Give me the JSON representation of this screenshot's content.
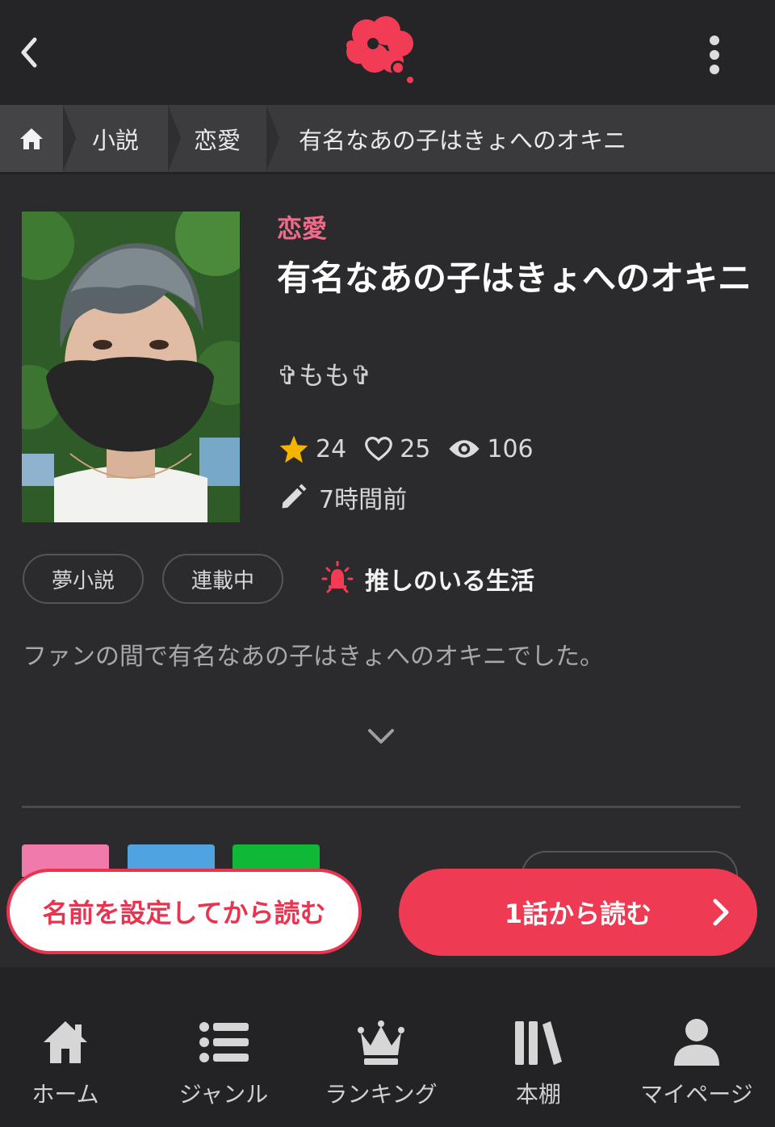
{
  "header": {
    "back_icon": "chevron-left-icon",
    "logo_icon": "cloud-logo-icon",
    "menu_icon": "kebab-menu-icon",
    "brand_color": "#f23c55"
  },
  "breadcrumb": {
    "home_icon": "home-icon",
    "items": [
      "小説",
      "恋愛",
      "有名なあの子はきょへのオキニ"
    ]
  },
  "novel": {
    "genre": "恋愛",
    "title": "有名なあの子はきょへのオキニ",
    "author": "✞もも✞",
    "stars": "24",
    "likes": "25",
    "views": "106",
    "updated": "7時間前",
    "tags": [
      "夢小説",
      "連載中"
    ],
    "contest": "推しのいる生活",
    "synopsis": "ファンの間で有名なあの子はきょへのオキニでした。"
  },
  "actions": {
    "set_name_label": "名前を設定してから読む",
    "read_label": "1話から読む"
  },
  "colors": {
    "genre": "#f06a8a",
    "star": "#f5b400",
    "primary": "#ee3a52",
    "share_pink": "#f07aa9",
    "share_blue": "#4fa3e0",
    "share_green": "#10b838"
  },
  "bottom_nav": {
    "items": [
      {
        "label": "ホーム",
        "icon": "home-icon"
      },
      {
        "label": "ジャンル",
        "icon": "list-icon"
      },
      {
        "label": "ランキング",
        "icon": "crown-icon"
      },
      {
        "label": "本棚",
        "icon": "bookshelf-icon"
      },
      {
        "label": "マイページ",
        "icon": "user-icon"
      }
    ]
  }
}
